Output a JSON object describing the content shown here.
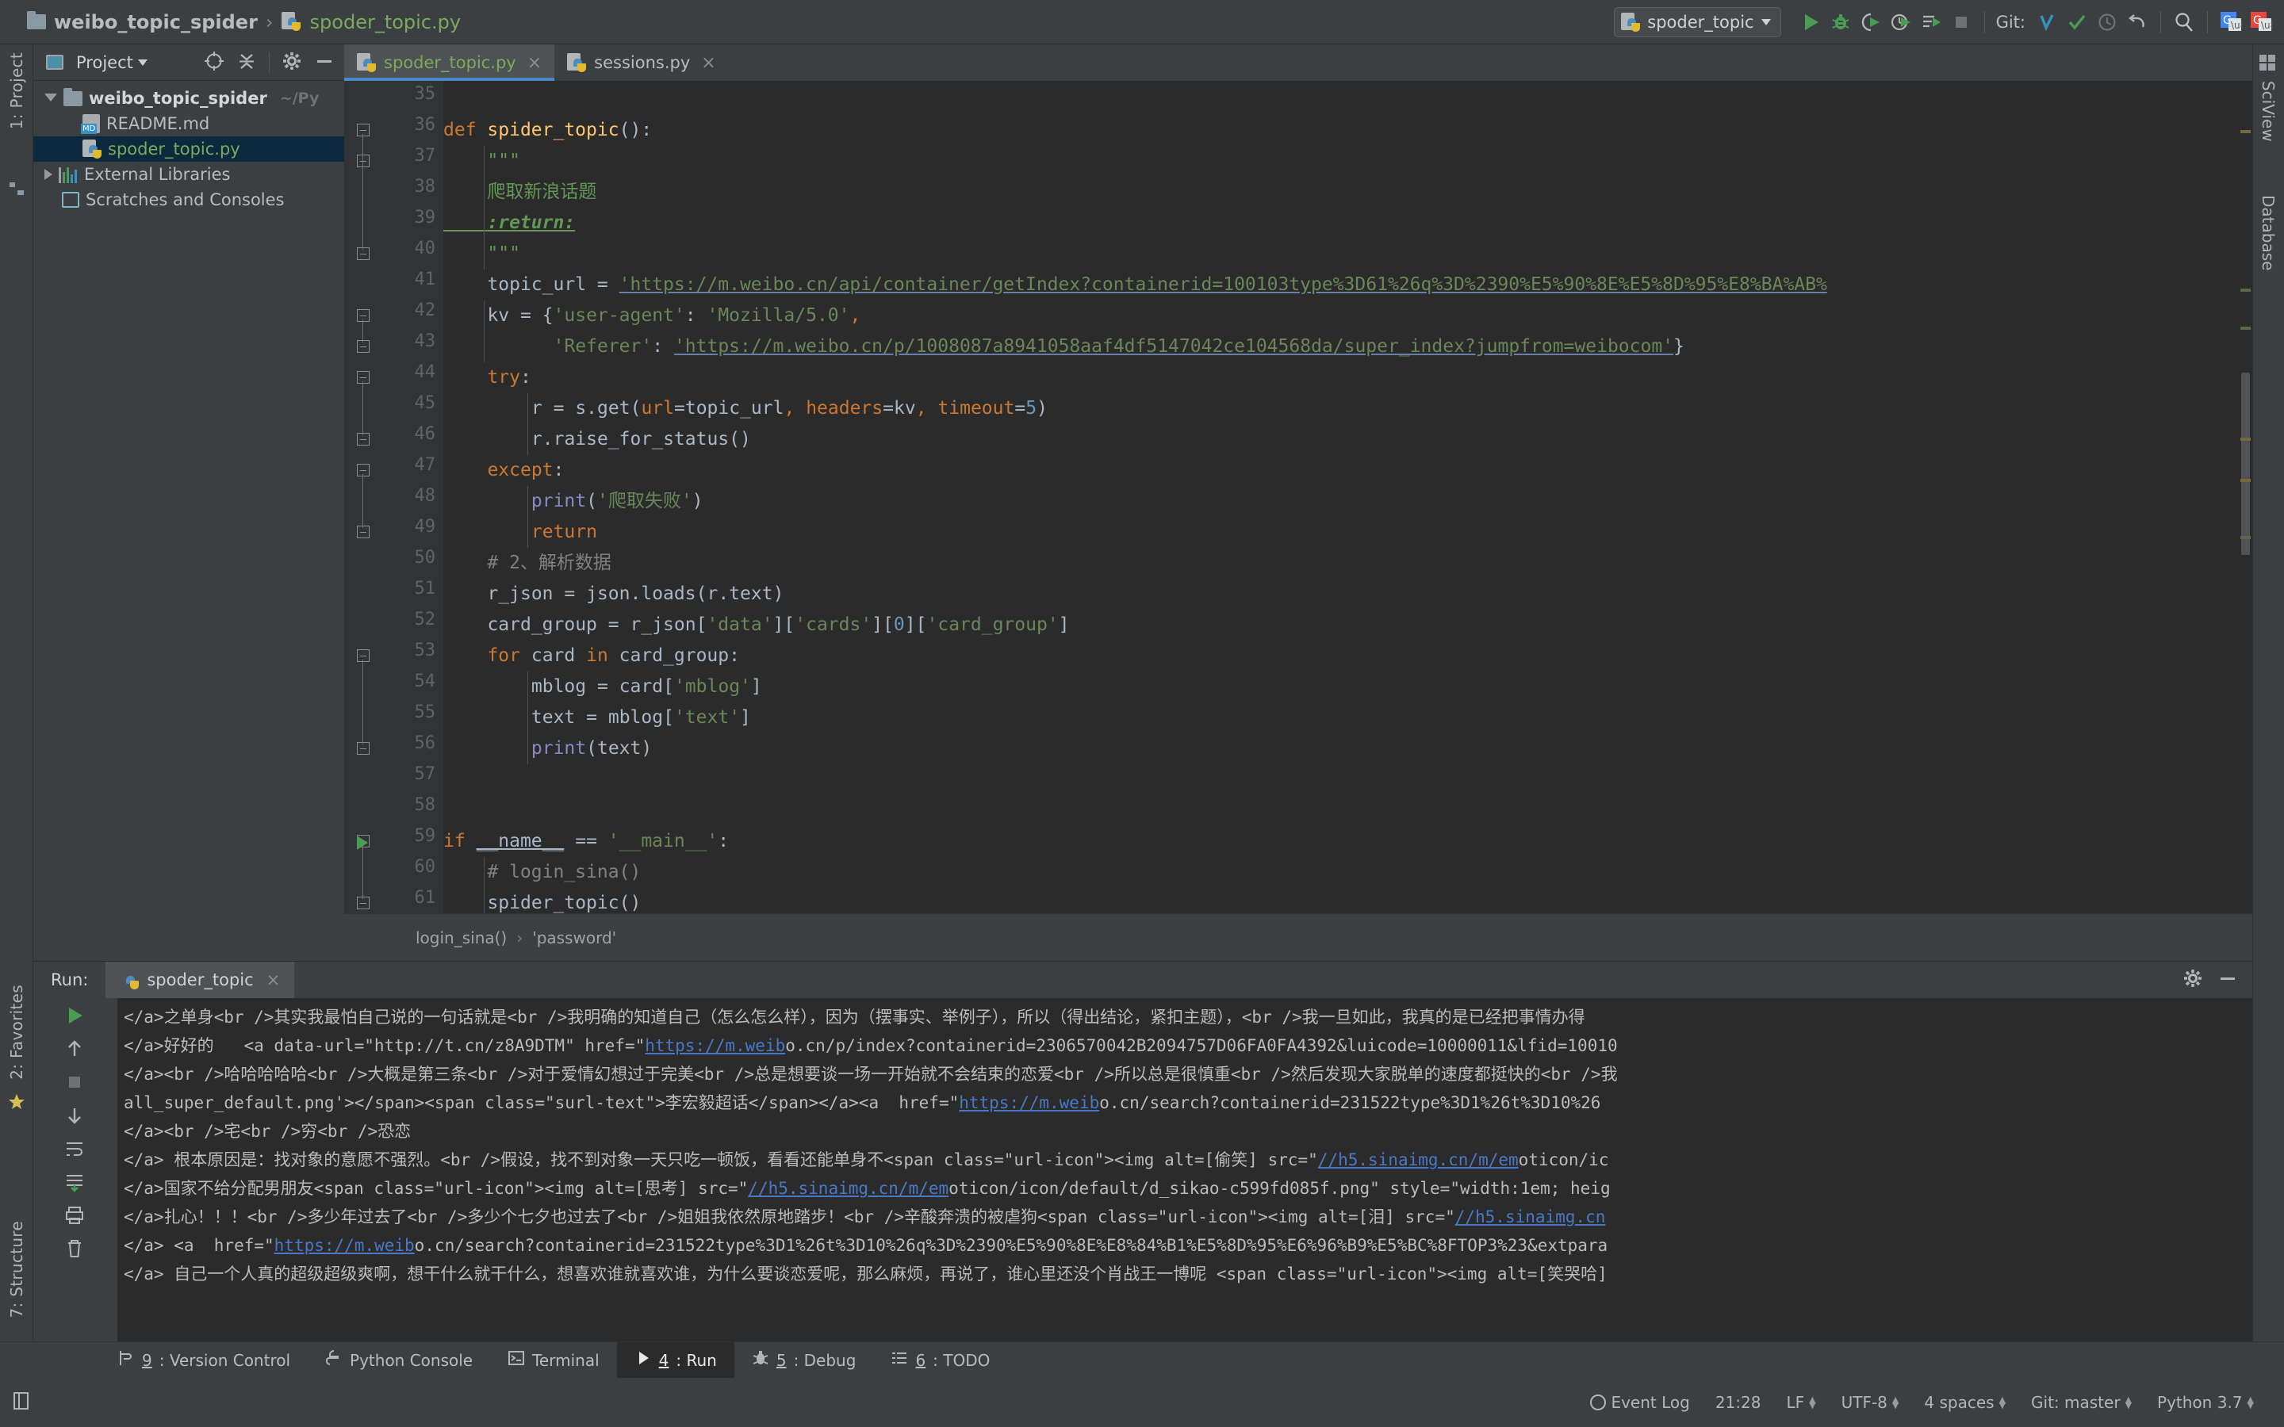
{
  "window": {
    "breadcrumb_project": "weibo_topic_spider",
    "breadcrumb_sep": "›",
    "breadcrumb_file": "spoder_topic.py"
  },
  "toolbar": {
    "run_config": "spoder_topic",
    "git_label": "Git:",
    "icons": [
      "run-icon",
      "debug-icon",
      "coverage-icon",
      "profile-icon",
      "run-with-params-icon",
      "stop-icon",
      "git-update-icon",
      "git-commit-icon",
      "git-history-icon",
      "git-revert-icon",
      "search-everywhere-icon",
      "translate-icon-blue",
      "translate-icon-red"
    ]
  },
  "sidebar_tabs": {
    "project": "1: Project",
    "favorites": "2: Favorites",
    "structure": "7: Structure"
  },
  "right_tabs": {
    "sciview": "SciView",
    "database": "Database"
  },
  "project_panel": {
    "title": "Project",
    "tree": [
      {
        "label": "weibo_topic_spider",
        "path": "~/Py",
        "icon": "folder-icon",
        "kind": "root",
        "expanded": true,
        "selected": false
      },
      {
        "label": "README.md",
        "path": "",
        "icon": "markdown-icon",
        "kind": "file",
        "expanded": false,
        "selected": false
      },
      {
        "label": "spoder_topic.py",
        "path": "",
        "icon": "python-file-icon",
        "kind": "file",
        "expanded": false,
        "selected": true
      },
      {
        "label": "External Libraries",
        "path": "",
        "icon": "library-icon",
        "kind": "group",
        "expanded": false,
        "selected": false
      },
      {
        "label": "Scratches and Consoles",
        "path": "",
        "icon": "scratches-icon",
        "kind": "group",
        "expanded": false,
        "selected": false
      }
    ]
  },
  "editor": {
    "tabs": [
      {
        "label": "spoder_topic.py",
        "active": true,
        "close": "×"
      },
      {
        "label": "sessions.py",
        "active": false,
        "close": "×"
      }
    ],
    "first_visible_line": 35,
    "breadcrumb": [
      "login_sina()",
      "'password'"
    ],
    "breadcrumb_sep": "›",
    "lines": [
      {
        "n": 35,
        "text": ""
      },
      {
        "n": 36,
        "text": "def spider_topic():"
      },
      {
        "n": 37,
        "text": "    \"\"\""
      },
      {
        "n": 38,
        "text": "    爬取新浪话题"
      },
      {
        "n": 39,
        "text": "    :return:"
      },
      {
        "n": 40,
        "text": "    \"\"\""
      },
      {
        "n": 41,
        "text": "    topic_url = 'https://m.weibo.cn/api/container/getIndex?containerid=100103type%3D61%26q%3D%2390%E5%90%8E%E5%8D%95%E8%BA%AB%"
      },
      {
        "n": 42,
        "text": "    kv = {'user-agent': 'Mozilla/5.0',"
      },
      {
        "n": 43,
        "text": "          'Referer': 'https://m.weibo.cn/p/1008087a8941058aaf4df5147042ce104568da/super_index?jumpfrom=weibocom'}"
      },
      {
        "n": 44,
        "text": "    try:"
      },
      {
        "n": 45,
        "text": "        r = s.get(url=topic_url, headers=kv, timeout=5)"
      },
      {
        "n": 46,
        "text": "        r.raise_for_status()"
      },
      {
        "n": 47,
        "text": "    except:"
      },
      {
        "n": 48,
        "text": "        print('爬取失败')"
      },
      {
        "n": 49,
        "text": "        return"
      },
      {
        "n": 50,
        "text": "    # 2、解析数据"
      },
      {
        "n": 51,
        "text": "    r_json = json.loads(r.text)"
      },
      {
        "n": 52,
        "text": "    card_group = r_json['data']['cards'][0]['card_group']"
      },
      {
        "n": 53,
        "text": "    for card in card_group:"
      },
      {
        "n": 54,
        "text": "        mblog = card['mblog']"
      },
      {
        "n": 55,
        "text": "        text = mblog['text']"
      },
      {
        "n": 56,
        "text": "        print(text)"
      },
      {
        "n": 57,
        "text": ""
      },
      {
        "n": 58,
        "text": ""
      },
      {
        "n": 59,
        "text": "if __name__ == '__main__':"
      },
      {
        "n": 60,
        "text": "    # login_sina()"
      },
      {
        "n": 61,
        "text": "    spider_topic()"
      }
    ]
  },
  "run_panel": {
    "label": "Run:",
    "tab": "spoder_topic",
    "close": "×",
    "console_lines": [
      "</a>之单身<br />其实我最怕自己说的一句话就是<br />我明确的知道自己（怎么怎么样），因为（摆事实、举例子），所以（得出结论，紧扣主题），<br />我一旦如此，我真的是已经把事情办得",
      "</a>好好的   <a data-url=\"http://t.cn/z8A9DTM\" href=\"https://m.weibo.cn/p/index?containerid=2306570042B2094757D06FA0FA4392&luicode=10000011&lfid=10010",
      "</a><br />哈哈哈哈哈<br />大概是第三条<br />对于爱情幻想过于完美<br />总是想要谈一场一开始就不会结束的恋爱<br />所以总是很慎重<br />然后发现大家脱单的速度都挺快的<br />我",
      "all_super_default.png'></span><span class=\"surl-text\">李宏毅超话</span></a><a  href=\"https://m.weibo.cn/search?containerid=231522type%3D1%26t%3D10%26",
      "</a><br />宅<br />穷<br />恐恋",
      "</a> 根本原因是：找对象的意愿不强烈。<br />假设，找不到对象一天只吃一顿饭，看看还能单身不<span class=\"url-icon\"><img alt=[偷笑] src=\"//h5.sinaimg.cn/m/emoticon/ic",
      "</a>国家不给分配男朋友<span class=\"url-icon\"><img alt=[思考] src=\"//h5.sinaimg.cn/m/emoticon/icon/default/d_sikao-c599fd085f.png\" style=\"width:1em; heig",
      "</a>扎心！！！<br />多少年过去了<br />多少个七夕也过去了<br />姐姐我依然原地踏步！<br />辛酸奔溃的被虐狗<span class=\"url-icon\"><img alt=[泪] src=\"//h5.sinaimg.cn",
      "</a> <a  href=\"https://m.weibo.cn/search?containerid=231522type%3D1%26t%3D10%26q%3D%2390%E5%90%8E%E8%84%B1%E5%8D%95%E6%96%B9%E5%BC%8FTOP3%23&extpara",
      "</a> 自己一个人真的超级超级爽啊，想干什么就干什么，想喜欢谁就喜欢谁，为什么要谈恋爱呢，那么麻烦，再说了，谁心里还没个肖战王一博呢 <span class=\"url-icon\"><img alt=[笑哭哈]"
    ]
  },
  "tool_strip": [
    {
      "num": "9",
      "label": ": Version Control",
      "icon": "version-control-icon",
      "active": false
    },
    {
      "num": "",
      "label": "Python Console",
      "icon": "python-console-icon",
      "active": false
    },
    {
      "num": "",
      "label": "Terminal",
      "icon": "terminal-icon",
      "active": false
    },
    {
      "num": "4",
      "label": ": Run",
      "icon": "run-icon",
      "active": true
    },
    {
      "num": "5",
      "label": ": Debug",
      "icon": "debug-icon",
      "active": false
    },
    {
      "num": "6",
      "label": ": TODO",
      "icon": "todo-icon",
      "active": false
    }
  ],
  "status_bar": {
    "caret": "21:28",
    "line_sep": "LF",
    "encoding": "UTF-8",
    "indent": "4 spaces",
    "git_branch": "Git: master",
    "interpreter": "Python 3.7",
    "event_log": "Event Log"
  },
  "colors": {
    "background": "#3c3f41",
    "editor_bg": "#2b2b2b",
    "accent_blue": "#4a88c7",
    "keyword_orange": "#cc7832",
    "string_green": "#6a8759",
    "function_yellow": "#ffc66d",
    "number_blue": "#6897bb",
    "builtin_purple": "#8888c6",
    "comment_gray": "#808080",
    "doc_green": "#629755",
    "link_blue": "#4a78c8",
    "selection_navy": "#0d293e"
  }
}
